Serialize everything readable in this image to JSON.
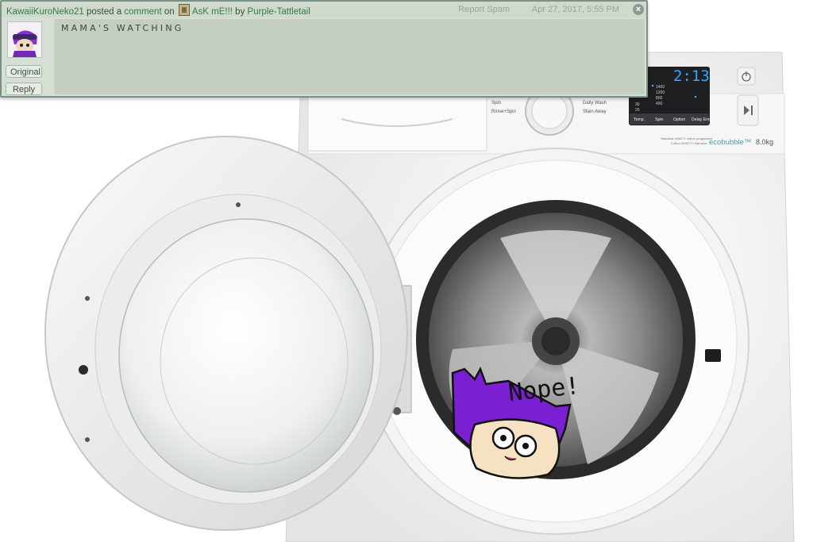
{
  "notification": {
    "author": "KawaiiKuroNeko21",
    "posted_text": "posted a",
    "comment_link": "comment",
    "on_text": "on",
    "deviation_title": "AsK mE!!!",
    "by_text": "by",
    "deviation_author": "Purple-Tattletail",
    "report_spam": "Report Spam",
    "timestamp": "Apr 27, 2017, 5:55 PM",
    "close_label": "×",
    "original_button": "Original",
    "reply_button": "Reply",
    "comment_text": "MAMA'S WATCHING"
  },
  "machine": {
    "display_time": "2:13",
    "spin_speeds": [
      "1400",
      "1200",
      "800",
      "400"
    ],
    "temps": [
      "30",
      "20"
    ],
    "dial_labels": [
      "Spin",
      "Rinse+Spin",
      "Daily Wash",
      "Stain Away"
    ],
    "buttons": [
      "Temp.",
      "Spin",
      "Option",
      "Delay End"
    ],
    "brand_line1": "Standard 40/60°C cotton programme",
    "brand_line2": "Cotton 40/60°C+Intensive",
    "brand": "ecobubble™",
    "capacity": "8.0kg"
  },
  "drawing": {
    "speech": "Nope!"
  },
  "colors": {
    "panel_bg": "#d6dfd3",
    "comment_bg": "#c4cfc1",
    "link": "#337c4a",
    "display_digits": "#2fa8ff",
    "cat_purple": "#7a1fd1"
  }
}
